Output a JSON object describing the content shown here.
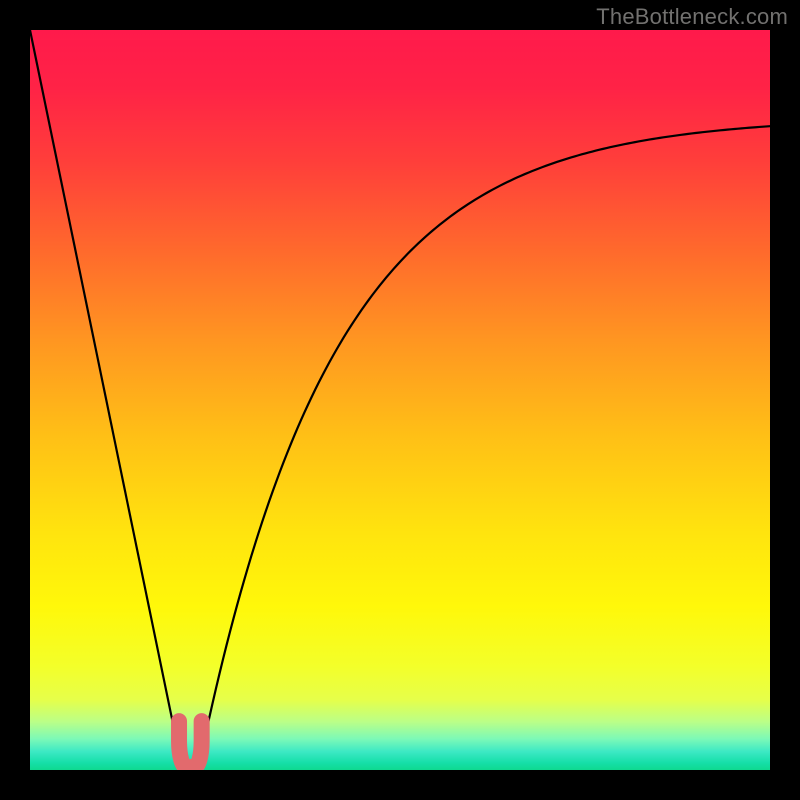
{
  "attribution": "TheBottleneck.com",
  "gradient_stops": [
    {
      "offset": 0.0,
      "color": "#ff1a4b"
    },
    {
      "offset": 0.08,
      "color": "#ff2346"
    },
    {
      "offset": 0.18,
      "color": "#ff3f3a"
    },
    {
      "offset": 0.3,
      "color": "#ff6a2c"
    },
    {
      "offset": 0.42,
      "color": "#ff9621"
    },
    {
      "offset": 0.55,
      "color": "#ffc016"
    },
    {
      "offset": 0.68,
      "color": "#ffe40e"
    },
    {
      "offset": 0.78,
      "color": "#fff80a"
    },
    {
      "offset": 0.86,
      "color": "#f3ff2a"
    },
    {
      "offset": 0.905,
      "color": "#e6ff4a"
    },
    {
      "offset": 0.935,
      "color": "#baff88"
    },
    {
      "offset": 0.958,
      "color": "#7cf9b7"
    },
    {
      "offset": 0.975,
      "color": "#3de9c4"
    },
    {
      "offset": 0.99,
      "color": "#16dfa9"
    },
    {
      "offset": 1.0,
      "color": "#0fd98f"
    }
  ],
  "plot": {
    "x_min": 0.0,
    "x_max": 3.6,
    "x_at_min": 0.78,
    "well_half_width": 0.055,
    "well_depth": 0.023
  },
  "marker": {
    "color": "#e26a6d",
    "width_u": 0.11,
    "height_u": 0.062,
    "corner_u": 0.035,
    "thickness_px": 16
  },
  "chart_data": {
    "type": "line",
    "title": "",
    "xlabel": "",
    "ylabel": "",
    "xlim": [
      0.0,
      3.6
    ],
    "ylim": [
      0.0,
      1.0
    ],
    "grid": false,
    "legend": false,
    "series": [
      {
        "name": "bottleneck-curve",
        "x": [
          0.0,
          0.1,
          0.2,
          0.3,
          0.4,
          0.5,
          0.6,
          0.7,
          0.725,
          0.78,
          0.835,
          0.86,
          0.95,
          1.1,
          1.3,
          1.5,
          1.8,
          2.1,
          2.4,
          2.8,
          3.2,
          3.6
        ],
        "values": [
          1.0,
          0.872,
          0.744,
          0.615,
          0.487,
          0.359,
          0.231,
          0.103,
          0.023,
          0.0,
          0.023,
          0.103,
          0.218,
          0.355,
          0.484,
          0.57,
          0.663,
          0.726,
          0.772,
          0.815,
          0.846,
          0.87
        ]
      }
    ],
    "annotations": [
      {
        "type": "u-marker",
        "x_center": 0.78,
        "y_bottom": 0.0,
        "width": 0.11,
        "height": 0.062,
        "color": "#e26a6d"
      }
    ],
    "notes": "y represents bottleneck fraction (0 at curve minimum, 1 at top). Values estimated from pixel positions; chart has no visible axes or ticks."
  }
}
